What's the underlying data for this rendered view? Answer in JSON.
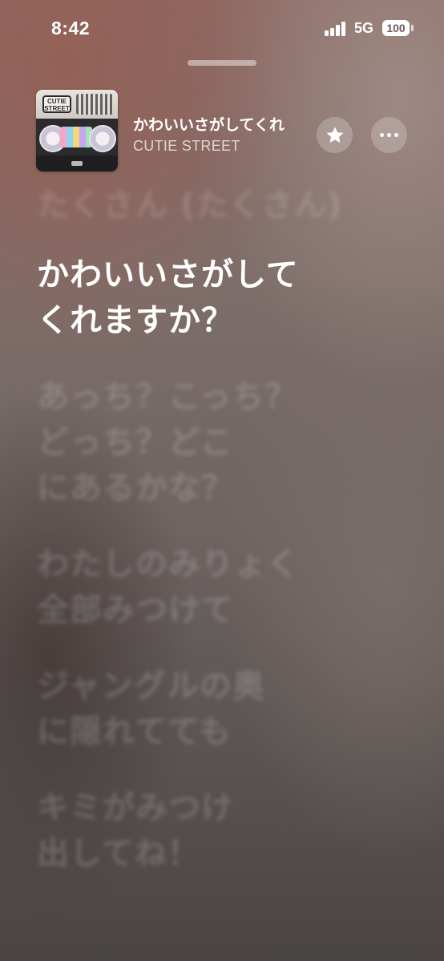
{
  "status_bar": {
    "time": "8:42",
    "network": "5G",
    "battery": "100"
  },
  "now_playing": {
    "title": "かわいいさがしてくれ",
    "artist": "CUTIE STREET",
    "album_art_text": "CUTIE STREET"
  },
  "icons": {
    "favorite": "star-icon",
    "more": "ellipsis-icon"
  },
  "lyrics": [
    {
      "text": "たくさん (たくさん)",
      "state": "past"
    },
    {
      "text": "かわいいさがして\nくれますか？",
      "state": "active"
    },
    {
      "text": "あっち？こっち？\nどっち？どこ\nにあるかな？",
      "state": "upcoming"
    },
    {
      "text": "わたしのみりょく\n全部みつけて",
      "state": "upcoming"
    },
    {
      "text": "ジャングルの奥\nに隠れてても",
      "state": "upcoming"
    },
    {
      "text": "キミがみつけ\n出してね！",
      "state": "upcoming"
    }
  ]
}
